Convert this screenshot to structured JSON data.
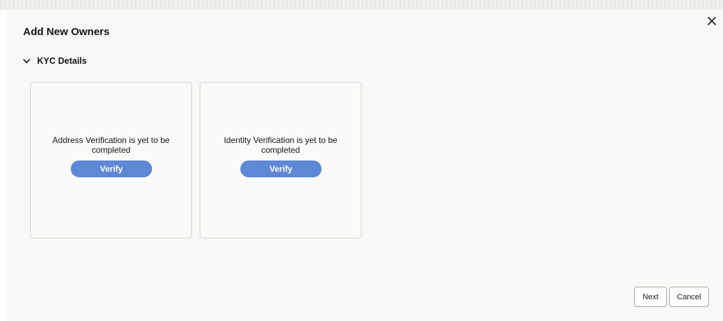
{
  "dialog": {
    "title": "Add New Owners",
    "close_icon": "close-icon"
  },
  "section": {
    "title": "KYC Details",
    "toggle_icon": "chevron-down-icon"
  },
  "cards": [
    {
      "text": "Address Verification is yet to be completed",
      "button_label": "Verify"
    },
    {
      "text": "Identity Verification is yet to be completed",
      "button_label": "Verify"
    }
  ],
  "footer": {
    "next_label": "Next",
    "cancel_label": "Cancel"
  },
  "colors": {
    "verify_button": "#5e87d6",
    "dialog_background": "#f9f8f6",
    "text": "#161513"
  }
}
